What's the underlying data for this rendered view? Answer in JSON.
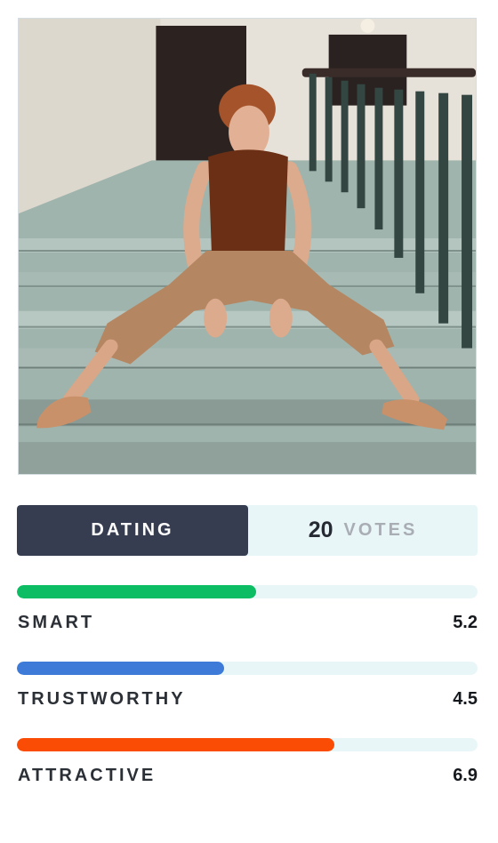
{
  "photo": {
    "alt_icon": "profile-photo"
  },
  "category": {
    "label": "DATING",
    "votes_count": "20",
    "votes_label": "VOTES"
  },
  "metrics": [
    {
      "name": "SMART",
      "value": "5.2",
      "fraction": 0.52,
      "color": "#0cbd63"
    },
    {
      "name": "TRUSTWORTHY",
      "value": "4.5",
      "fraction": 0.45,
      "color": "#3e7bd8"
    },
    {
      "name": "ATTRACTIVE",
      "value": "6.9",
      "fraction": 0.69,
      "color": "#fb4c05"
    }
  ],
  "colors": {
    "tab_background": "#363d51",
    "track_background": "#e9f6f8"
  }
}
